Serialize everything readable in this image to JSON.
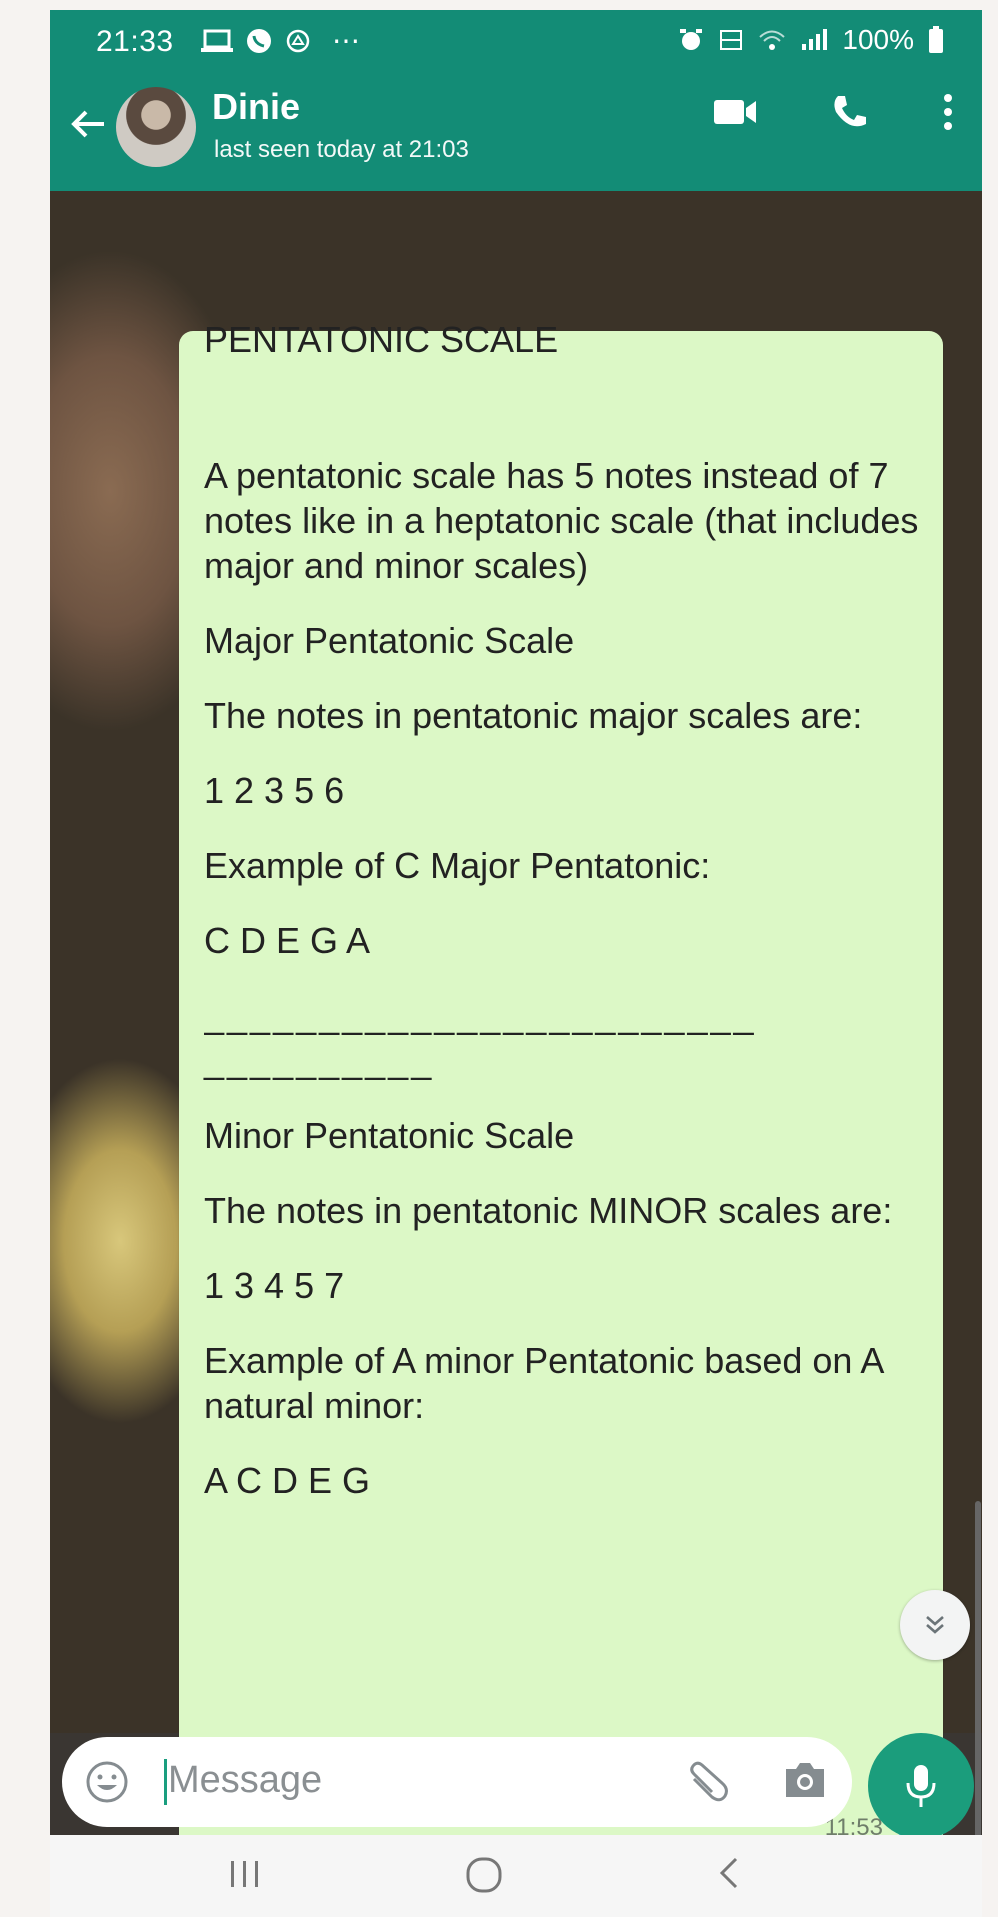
{
  "status_bar": {
    "time": "21:33",
    "more": "⋯",
    "battery": "100%",
    "icons": [
      "laptop-icon",
      "whatsapp-icon",
      "sync-icon",
      "alarm-icon",
      "volte-icon",
      "wifi-icon",
      "signal-icon",
      "battery-icon"
    ]
  },
  "chat_header": {
    "contact_name": "Dinie",
    "last_seen": "last seen today at 21:03",
    "actions": [
      "video-call-icon",
      "voice-call-icon",
      "more-options-icon"
    ]
  },
  "message": {
    "lines": [
      "PENTATONIC SCALE",
      "",
      "A pentatonic scale has 5 notes instead of 7 notes like in a heptatonic scale (that includes major and minor scales)",
      "",
      "Major Pentatonic Scale",
      "",
      "The notes in pentatonic major scales are:",
      "",
      "1 2 3 5 6",
      "",
      "Example of C Major Pentatonic:",
      "",
      "C D E G A",
      "",
      "________________________",
      "__________",
      "",
      "Minor Pentatonic Scale",
      "",
      "The notes in pentatonic MINOR scales are:",
      "",
      "1 3 4 5 7",
      "",
      "Example of A minor Pentatonic based on A natural minor:",
      "",
      "A C D E G"
    ],
    "time": "11:53",
    "status_icon": "double-check-icon"
  },
  "composer": {
    "placeholder": "Message",
    "icons": [
      "emoji-icon",
      "attach-icon",
      "camera-icon",
      "mic-icon"
    ]
  },
  "nav_bar": {
    "buttons": [
      "recents-icon",
      "home-icon",
      "back-icon"
    ]
  },
  "colors": {
    "header": "#138c76",
    "bubble": "#dcf8c6",
    "accent": "#1b9d7c"
  }
}
